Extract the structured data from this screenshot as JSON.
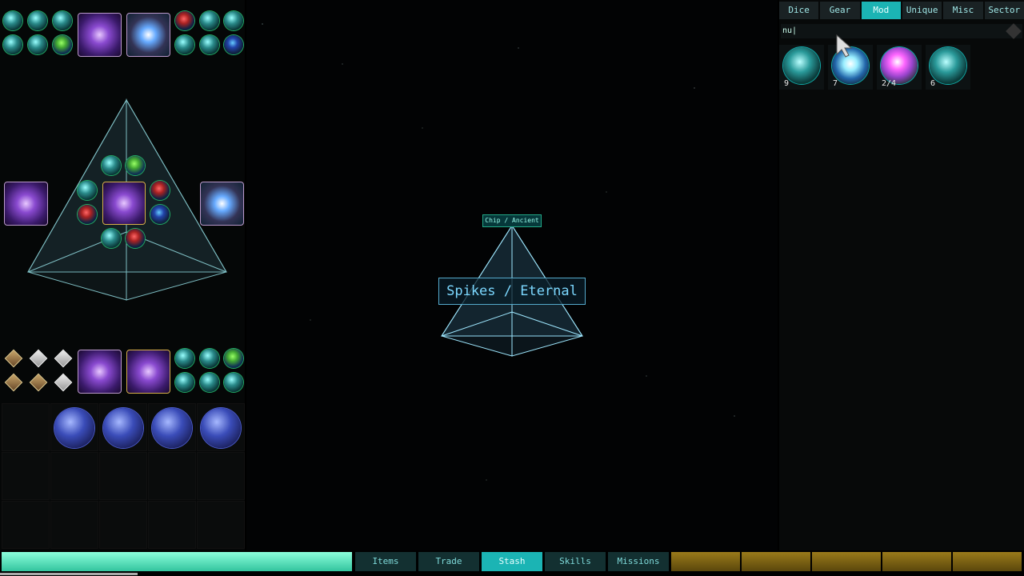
{
  "tabs": [
    {
      "label": "Dice",
      "active": false
    },
    {
      "label": "Gear",
      "active": false
    },
    {
      "label": "Mod",
      "active": true
    },
    {
      "label": "Unique",
      "active": false
    },
    {
      "label": "Misc",
      "active": false
    },
    {
      "label": "Sector",
      "active": false
    }
  ],
  "search": {
    "value": "nu|"
  },
  "results": [
    {
      "count": "9"
    },
    {
      "count": "7"
    },
    {
      "count": "2/4"
    },
    {
      "count": "6"
    }
  ],
  "center": {
    "chip_label": "Chip / Ancient",
    "title": "Spikes / Eternal"
  },
  "bottom_nav": [
    {
      "label": "Items",
      "active": false
    },
    {
      "label": "Trade",
      "active": false
    },
    {
      "label": "Stash",
      "active": true
    },
    {
      "label": "Skills",
      "active": false
    },
    {
      "label": "Missions",
      "active": false
    }
  ],
  "colors": {
    "accent": "#1bb4b4",
    "title_text": "#7cd8ff",
    "gold": "#9a7a1a"
  }
}
